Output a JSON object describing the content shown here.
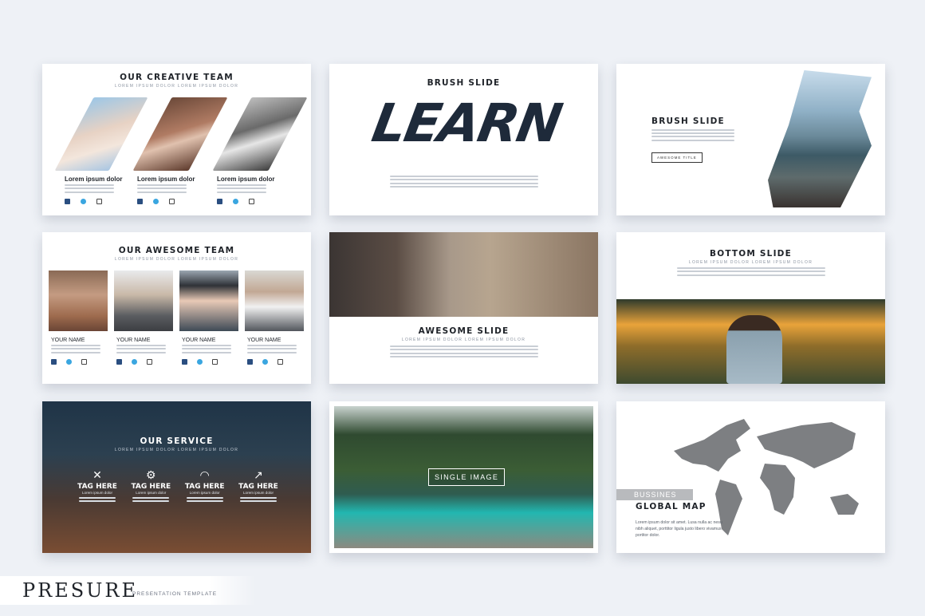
{
  "brand": {
    "title": "PRESURE",
    "subtitle": "PRESENTATION TEMPLATE"
  },
  "slides": {
    "creative_team": {
      "title": "OUR CREATIVE TEAM",
      "subtitle": "LOREM IPSUM DOLOR LOREM IPSUM DOLOR",
      "members": [
        {
          "name": "Lorem ipsum dolor"
        },
        {
          "name": "Lorem ipsum dolor"
        },
        {
          "name": "Lorem ipsum dolor"
        }
      ]
    },
    "brush_learn": {
      "title": "BRUSH SLIDE",
      "word": "LEARN"
    },
    "brush_mountain": {
      "title": "BRUSH SLIDE",
      "button": "AWESOME TITLE"
    },
    "awesome_team": {
      "title": "OUR AWESOME TEAM",
      "subtitle": "LOREM IPSUM DOLOR LOREM IPSUM DOLOR",
      "members": [
        {
          "name": "YOUR NAME"
        },
        {
          "name": "YOUR NAME"
        },
        {
          "name": "YOUR NAME"
        },
        {
          "name": "YOUR NAME"
        }
      ]
    },
    "awesome_slide": {
      "title": "AWESOME SLIDE",
      "subtitle": "LOREM IPSUM DOLOR LOREM IPSUM DOLOR"
    },
    "bottom_slide": {
      "title": "BOTTOM SLIDE",
      "subtitle": "LOREM IPSUM DOLOR LOREM IPSUM DOLOR"
    },
    "service": {
      "title": "OUR SERVICE",
      "subtitle": "LOREM IPSUM DOLOR LOREM IPSUM DOLOR",
      "items": [
        {
          "icon": "tools-icon",
          "label": "TAG HERE",
          "text": "Lorem ipsum dolor"
        },
        {
          "icon": "gear-icon",
          "label": "TAG HERE",
          "text": "Lorem ipsum dolor"
        },
        {
          "icon": "wifi-icon",
          "label": "TAG HERE",
          "text": "Lorem ipsum dolor"
        },
        {
          "icon": "chart-icon",
          "label": "TAG HERE",
          "text": "Lorem ipsum dolor"
        }
      ]
    },
    "single_image": {
      "label": "SINGLE IMAGE"
    },
    "global_map": {
      "label": "BUSSINES",
      "title": "GLOBAL MAP",
      "text": "Lorem ipsum dolor sit amet. Lusa nulla ac nesu nibh aliquet, porttitor ligula justo libero vivamus portitor dolor."
    }
  },
  "colors": {
    "accent": "#3aa6e0",
    "facebook": "#2a4e80",
    "dark": "#1f2329",
    "teal": "#22b7b0"
  }
}
